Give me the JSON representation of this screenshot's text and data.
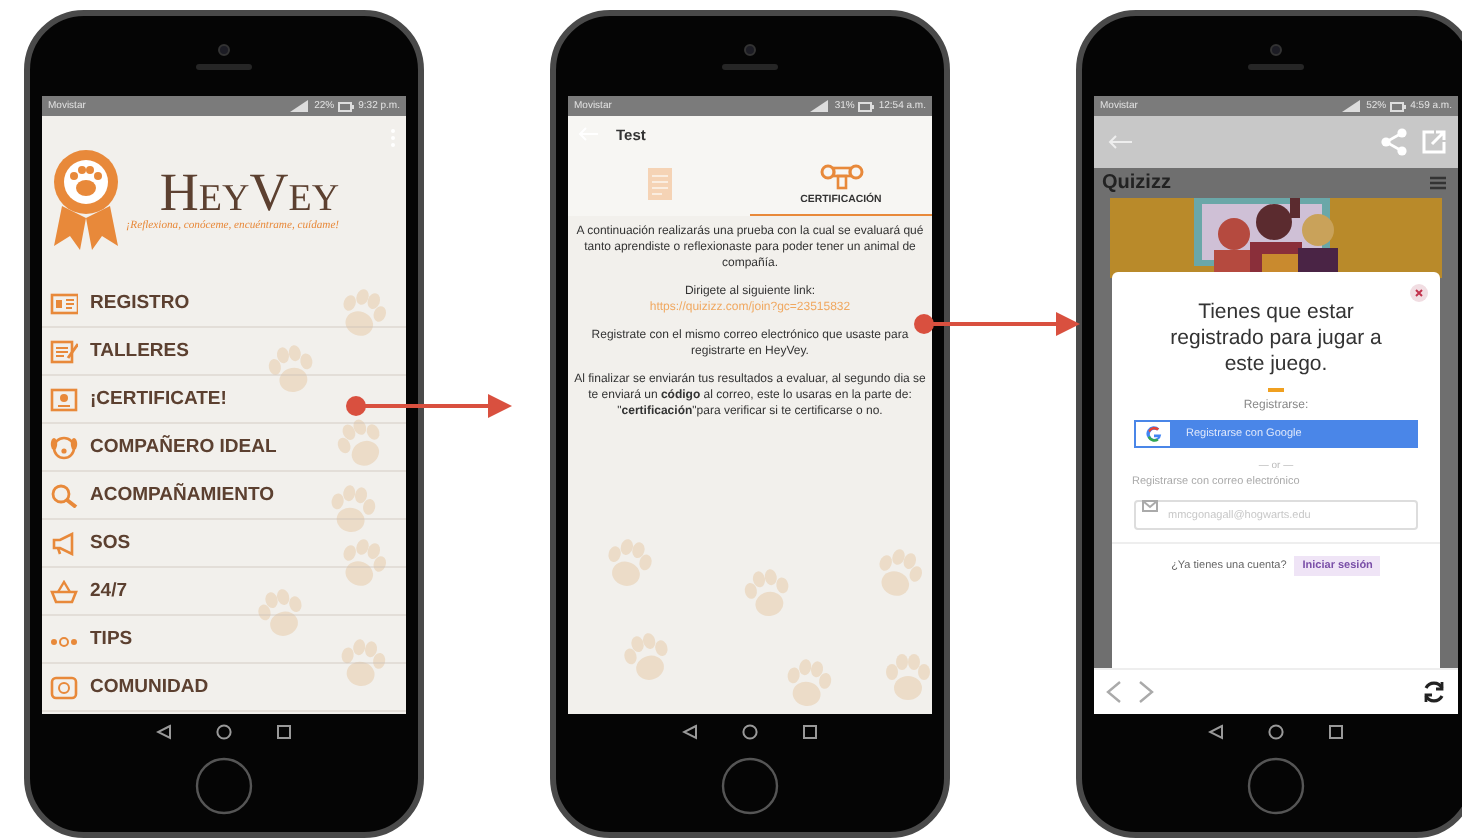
{
  "phones": [
    {
      "kind": "menu",
      "status_bar": {
        "carrier": "Movistar",
        "battery": "22%",
        "time": "9:32 p.m."
      },
      "brand": {
        "name": "HeyVey",
        "tagline": "¡Reflexiona, conóceme, encuéntrame, cuídame!"
      },
      "menu": [
        {
          "label": "REGISTRO"
        },
        {
          "label": "TALLERES"
        },
        {
          "label": "¡CERTIFICATE!"
        },
        {
          "label": "COMPAÑERO IDEAL"
        },
        {
          "label": "ACOMPAÑAMIENTO"
        },
        {
          "label": "SOS"
        },
        {
          "label": "24/7"
        },
        {
          "label": "TIPS"
        },
        {
          "label": "COMUNIDAD"
        }
      ]
    },
    {
      "kind": "test",
      "status_bar": {
        "carrier": "Movistar",
        "battery": "31%",
        "time": "12:54 a.m."
      },
      "header": {
        "title": "Test"
      },
      "tabs": [
        {
          "selected": false
        },
        {
          "label": "CERTIFICACIÓN",
          "selected": true
        }
      ],
      "body": [
        {
          "kind": "text",
          "text": "A continuación realizarás una prueba con la cual se evaluará qué tanto aprendiste o reflexionaste para poder tener un animal de compañía."
        },
        {
          "kind": "text",
          "text": "Dirigete al siguiente link:"
        },
        {
          "kind": "link",
          "text": "https://quizizz.com/join?gc=23515832"
        },
        {
          "kind": "text",
          "text": "Registrate con el mismo correo electrónico que usaste para registrarte en HeyVey."
        },
        {
          "kind": "text",
          "text": "Al finalizar se enviarán tus resultados a evaluar, al segundo dia se te enviará un **código** al correo, este lo usaras en la parte de: \"**certificación**\"para verificar si te certificarse o no."
        }
      ]
    },
    {
      "kind": "quiz",
      "status_bar": {
        "carrier": "Movistar",
        "battery": "52%",
        "time": "4:59 a.m."
      },
      "site": {
        "logo": "Quizizz"
      },
      "modal": {
        "title": "Tienes que estar registrado para jugar a este juego.",
        "signup_label": "Registrarse:",
        "google_button": "Registrarse con Google",
        "divider": "— or —",
        "email_label": "Registrarse con correo electrónico",
        "email_placeholder": "mmcgonagall@hogwarts.edu",
        "login_prompt": "¿Ya tienes una cuenta?",
        "login_button": "Iniciar sesión"
      }
    }
  ]
}
